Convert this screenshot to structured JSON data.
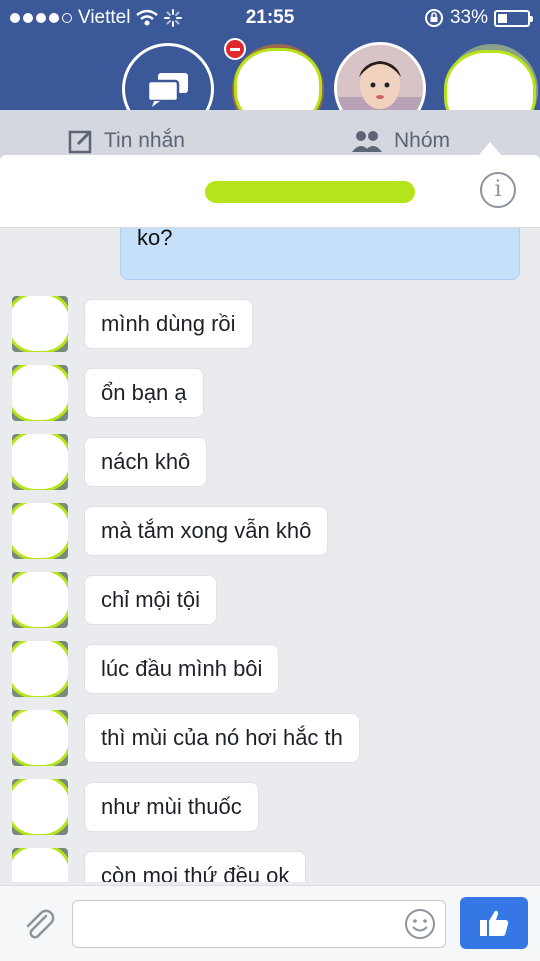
{
  "status_bar": {
    "carrier": "Viettel",
    "time": "21:55",
    "battery": "33%",
    "battery_level": 0.33
  },
  "tabs": {
    "messages": "Tin nhắn",
    "groups": "Nhóm"
  },
  "chat": {
    "outgoing_partial": "ko?",
    "messages": [
      "mình dùng rồi",
      "ổn bạn ạ",
      "nách khô",
      "mà tắm xong vẫn khô",
      "chỉ mội tội",
      "lúc đầu mình bôi",
      "thì mùi của nó hơi hắc th",
      "như mùi thuốc",
      "còn mọi thứ đều ok"
    ]
  },
  "composer": {
    "placeholder": ""
  },
  "icons": {
    "wifi": "wifi-icon",
    "loading": "activity-spinner-icon",
    "lock": "rotation-lock-icon",
    "battery": "battery-icon",
    "chat": "chat-bubbles-icon",
    "compose": "compose-icon",
    "group": "group-icon",
    "info": "info-icon",
    "attach": "paperclip-icon",
    "emoji": "smiley-icon",
    "like": "thumbs-up-icon"
  },
  "colors": {
    "header": "#3b5998",
    "scribble": "#b6e41a",
    "outgoing_bubble": "#c6e0f9",
    "like_button": "#3578e5"
  }
}
